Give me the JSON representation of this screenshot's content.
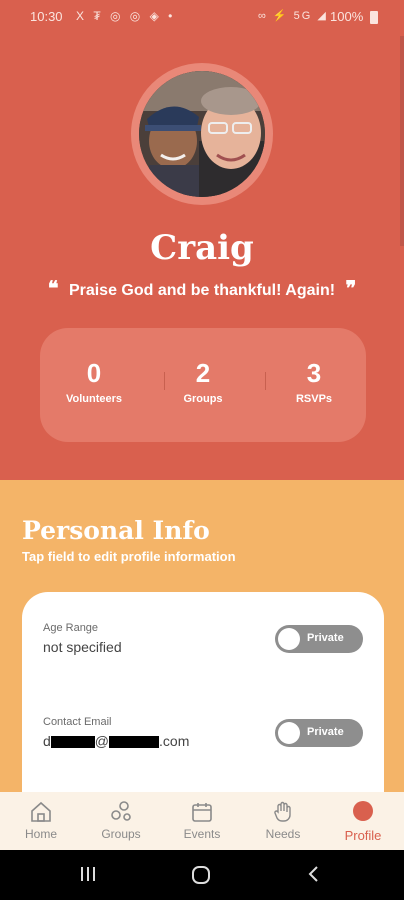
{
  "status_bar": {
    "time": "10:30",
    "left_icons": "X ₮ ◎ ◎ ◈ •",
    "right_icons": "∞ ⚡ 5G ◢",
    "battery": "100%"
  },
  "profile": {
    "name": "Craig",
    "quote": "Praise God and be thankful!  Again!",
    "quote_open": "❝",
    "quote_close": "❞"
  },
  "stats": [
    {
      "value": "0",
      "label": "Volunteers"
    },
    {
      "value": "2",
      "label": "Groups"
    },
    {
      "value": "3",
      "label": "RSVPs"
    }
  ],
  "personal_info": {
    "title": "Personal Info",
    "subtitle": "Tap field to edit profile information",
    "fields": [
      {
        "label": "Age Range",
        "value": "not specified",
        "privacy": "Private"
      },
      {
        "label": "Contact Email",
        "value_prefix": "d",
        "value_at": "@",
        "value_suffix": ".com",
        "privacy": "Private"
      }
    ]
  },
  "tabs": [
    {
      "label": "Home",
      "icon": "home-icon"
    },
    {
      "label": "Groups",
      "icon": "groups-icon"
    },
    {
      "label": "Events",
      "icon": "calendar-icon"
    },
    {
      "label": "Needs",
      "icon": "hand-icon"
    },
    {
      "label": "Profile",
      "icon": "profile-icon",
      "active": true
    }
  ],
  "colors": {
    "hero_bg": "#d9604e",
    "info_bg": "#f4b468",
    "accent": "#d9604e"
  }
}
